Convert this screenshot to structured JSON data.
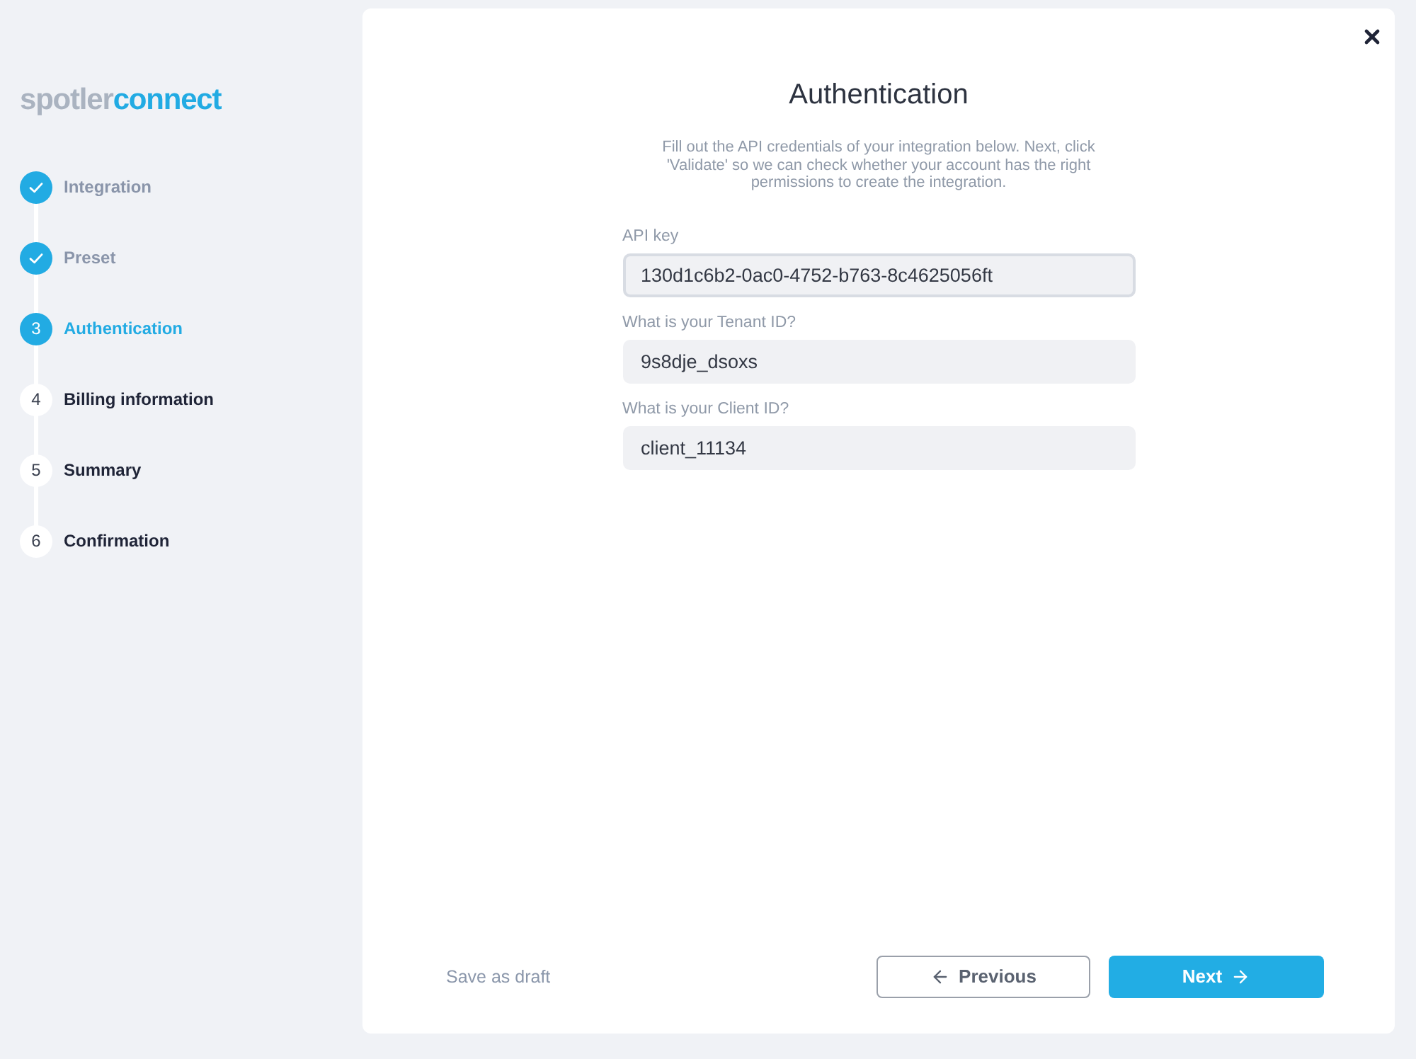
{
  "logo": {
    "primary": "spotler",
    "accent": "connect"
  },
  "steps": [
    {
      "label": "Integration",
      "completed": true,
      "selected": false
    },
    {
      "label": "Preset",
      "completed": true,
      "selected": false
    },
    {
      "number": "3",
      "label": "Authentication",
      "completed": false,
      "selected": true
    },
    {
      "number": "4",
      "label": "Billing information",
      "completed": false,
      "selected": false
    },
    {
      "number": "5",
      "label": "Summary",
      "completed": false,
      "selected": false
    },
    {
      "number": "6",
      "label": "Confirmation",
      "completed": false,
      "selected": false
    }
  ],
  "page": {
    "title": "Authentication",
    "description": "Fill out the API credentials of your integration below. Next, click 'Validate' so we can check whether your account has the right permissions to create the integration."
  },
  "fields": [
    {
      "label": "API key",
      "value": "130d1c6b2-0ac0-4752-b763-8c4625056ft",
      "focused": true
    },
    {
      "label": "What is your Tenant ID?",
      "value": "9s8dje_dsoxs",
      "focused": false
    },
    {
      "label": "What is your Client ID?",
      "value": "client_11134",
      "focused": false
    }
  ],
  "footer": {
    "save_draft": "Save as draft",
    "previous": "Previous",
    "next": "Next"
  }
}
